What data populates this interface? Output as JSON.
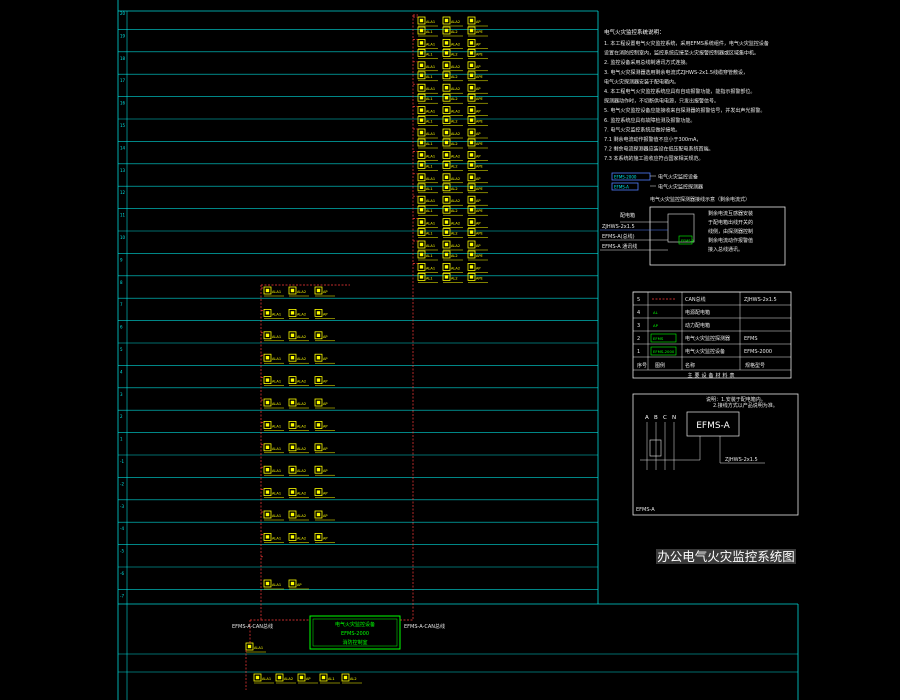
{
  "colors": {
    "background": "#000000",
    "grid": "#00d7d7",
    "device": "#ffff00",
    "bus": "#ff3b3b",
    "text": "#e8e8e8",
    "green": "#00ff00",
    "blue": "#4f7cff"
  },
  "floors": [
    "20",
    "19",
    "18",
    "17",
    "16",
    "15",
    "14",
    "13",
    "12",
    "11",
    "10",
    "9",
    "8",
    "7",
    "6",
    "5",
    "4",
    "3",
    "2",
    "1",
    "-1",
    "-2",
    "-3",
    "-4",
    "-5",
    "-6",
    "-7",
    "-8",
    "-9"
  ],
  "device_labels": [
    "ALA1",
    "ALA2",
    "AP",
    "AL1",
    "AL2",
    "APE"
  ],
  "notes": {
    "heading": "电气火灾监控系统说明：",
    "items": [
      "1. 本工程设置电气火灾监控系统，采用EFMS系统组件，电气火灾监控设备",
      "   设置在消防控制室内，监控系统应接至火灾报警控制器或区域集中机。",
      "2. 监控设备采用总线制通讯方式连接。",
      "3. 电气火灾探测器选用剩余电流式ZJHWS-2x1.5线缆穿管敷设，",
      "   电气火灾探测器安装于配电箱内。",
      "4. 本工程电气火灾监控系统应具有自动报警功能，能指示报警部位。",
      "   探测器动作时，不切断供电电源，只发出报警信号。",
      "5. 电气火灾监控设备应能接收来自探测器的报警信号，并发出声光报警。",
      "6. 监控系统应具有故障检测及报警功能。",
      "7. 电气火灾监控系统应做好接地。",
      "7.1 剩余电流动作报警值不应小于300mA，",
      "7.2 剩余电流探测器应装设在低压配电系统首端。",
      "7.3 本系统的施工验收应符合国家相关规范。"
    ]
  },
  "legend_small": [
    {
      "tag": "EFMS-2000",
      "desc": "电气火灾监控设备"
    },
    {
      "tag": "EFMS-A",
      "desc": "电气火灾监控探测器"
    }
  ],
  "wiring": {
    "title": "电气火灾监控探测器接线示意（剩余电流式）",
    "left_labels": [
      "配电箱",
      "ZJHWS-2x1.5",
      "EFMS-A(总线)",
      "EFMS-A 通讯线"
    ],
    "right_lines": [
      "剩余电流互感器安装",
      "于配电箱出线开关的",
      "线侧，由探测器控制",
      "剩余电流动作报警值",
      "接入总线通讯。"
    ]
  },
  "materials_table": {
    "rows": [
      {
        "no": "5",
        "symbol": "----",
        "name": "CAN总线",
        "model": "ZJHWS-2x1.5"
      },
      {
        "no": "4",
        "symbol": "AL",
        "name": "电源配电箱",
        "model": ""
      },
      {
        "no": "3",
        "symbol": "AP",
        "name": "动力配电箱",
        "model": ""
      },
      {
        "no": "2",
        "symbol": "EFMS",
        "name": "电气火灾监控探测器",
        "model": "EFMS"
      },
      {
        "no": "1",
        "symbol": "EFMS-2000",
        "name": "电气火灾监控设备",
        "model": "EFMS-2000"
      }
    ],
    "header": {
      "no": "序号",
      "symbol": "图例",
      "name": "名称",
      "model": "规格型号"
    },
    "caption": "主要设备材料表"
  },
  "detail": {
    "phases": [
      "A",
      "B",
      "C",
      "N"
    ],
    "device": "EFMS-A",
    "out_label": "ZJHWS-2x1.5",
    "notes": [
      "说明：1.安装于配电箱内。",
      "2.接线方式以产品说明为准。"
    ],
    "footer": "EFMS-A"
  },
  "title": "办公电气火灾监控系统图",
  "control_room": {
    "lines": [
      "电气火灾监控设备",
      "EFMS-2000",
      "消防控制室"
    ],
    "left_label": "EFMS-A-CAN总线",
    "right_label": "EFMS-A-CAN总线"
  }
}
